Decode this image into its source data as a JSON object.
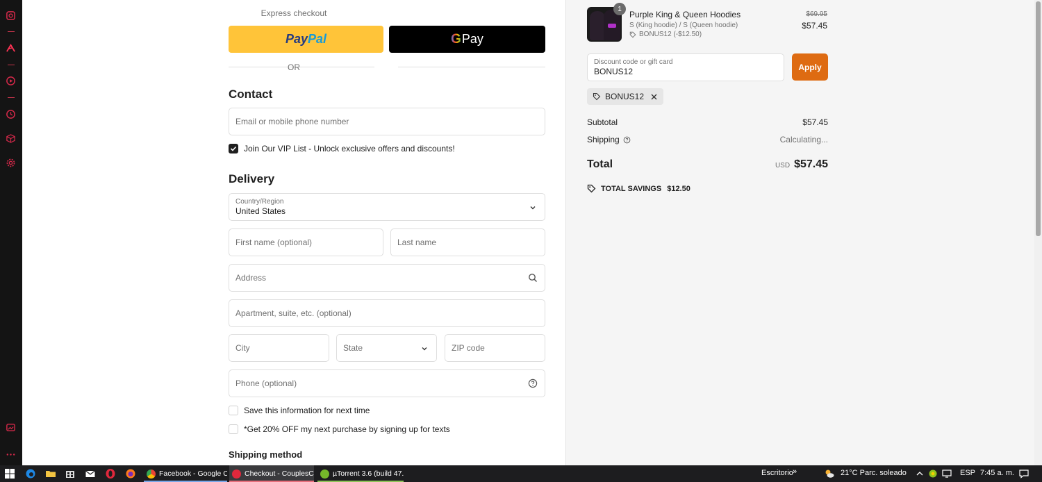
{
  "sidebar": {
    "icons": [
      "history-icon",
      "aria-icon",
      "player-icon",
      "clock-icon",
      "cube-icon",
      "settings-icon",
      "snapshot-icon",
      "more-icon"
    ]
  },
  "express": {
    "label": "Express checkout",
    "paypal_a": "Pay",
    "paypal_b": "Pal",
    "gpay_g": "G",
    "gpay_pay": "Pay",
    "or_label": "OR"
  },
  "contact": {
    "heading": "Contact",
    "email_placeholder": "Email or mobile phone number",
    "vip_label": "Join Our VIP List - Unlock exclusive offers and discounts!",
    "vip_checked": true
  },
  "delivery": {
    "heading": "Delivery",
    "country_label": "Country/Region",
    "country_value": "United States",
    "first_name_placeholder": "First name (optional)",
    "last_name_placeholder": "Last name",
    "address_placeholder": "Address",
    "apartment_placeholder": "Apartment, suite, etc. (optional)",
    "city_placeholder": "City",
    "state_placeholder": "State",
    "zip_placeholder": "ZIP code",
    "phone_placeholder": "Phone (optional)",
    "save_info_label": "Save this information for next time",
    "texts_label": "*Get 20% OFF my next purchase by signing up for texts"
  },
  "shipping": {
    "heading": "Shipping method"
  },
  "summary": {
    "product": {
      "quantity": "1",
      "name": "Purple King & Queen Hoodies",
      "variant": "S (King hoodie) / S (Queen hoodie)",
      "discount_line": "BONUS12 (-$12.50)",
      "price_old": "$69.95",
      "price_new": "$57.45"
    },
    "discount_field_label": "Discount code or gift card",
    "discount_field_value": "BONUS12",
    "apply_label": "Apply",
    "applied_code": "BONUS12",
    "subtotal_label": "Subtotal",
    "subtotal_value": "$57.45",
    "shipping_label": "Shipping",
    "shipping_value": "Calculating...",
    "total_label": "Total",
    "currency": "USD",
    "total_value": "$57.45",
    "savings_label": "TOTAL SAVINGS",
    "savings_value": "$12.50",
    "accent_color": "#de6b12"
  },
  "taskbar": {
    "tasks": [
      {
        "label": "Facebook - Google C...",
        "color": "#4285f4"
      },
      {
        "label": "Checkout - CouplesC...",
        "color": "#e0283c"
      },
      {
        "label": "µTorrent 3.6  (build 47...",
        "color": "#76b82a"
      }
    ],
    "desktop_label": "Escritorio",
    "weather": "21°C  Parc. soleado",
    "language": "ESP",
    "time": "7:45 a. m."
  }
}
